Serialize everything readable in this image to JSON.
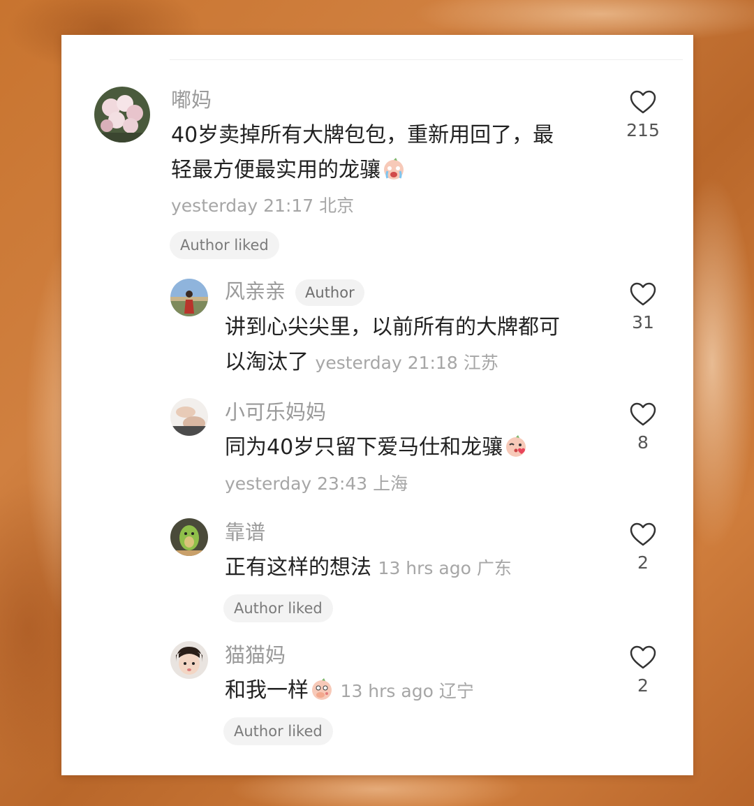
{
  "comments": [
    {
      "username": "嘟妈",
      "text": "40岁卖掉所有大牌包包，重新用回了，最轻最方便最实用的龙骧",
      "text_line1": "40岁卖掉所有大牌包包，重新用回了，最",
      "text_line2": "轻最方便最实用的龙骧",
      "emoji": "crying-face-emoji",
      "time": "yesterday 21:17 北京",
      "tag": "Author liked",
      "likes": "215"
    },
    {
      "username": "风亲亲",
      "badge": "Author",
      "text_line1": "讲到心尖尖里，以前所有的大牌都可",
      "text_line2": "以淘汰了",
      "time": "yesterday 21:18 江苏",
      "likes": "31"
    },
    {
      "username": "小可乐妈妈",
      "text": "同为40岁只留下爱马仕和龙骧",
      "emoji": "kiss-heart-emoji",
      "time": "yesterday 23:43 上海",
      "likes": "8"
    },
    {
      "username": "靠谱",
      "text": "正有这样的想法",
      "time": "13 hrs ago 广东",
      "tag": "Author liked",
      "likes": "2"
    },
    {
      "username": "猫猫妈",
      "text": "和我一样",
      "emoji": "hand-over-mouth-emoji",
      "time": "13 hrs ago 辽宁",
      "tag": "Author liked",
      "likes": "2"
    }
  ],
  "icons": {
    "like": "heart-outline-icon"
  },
  "colors": {
    "background": "#c8742f",
    "card": "#ffffff",
    "username": "#9a9a9a",
    "text": "#222222",
    "meta": "#a6a6a6"
  }
}
